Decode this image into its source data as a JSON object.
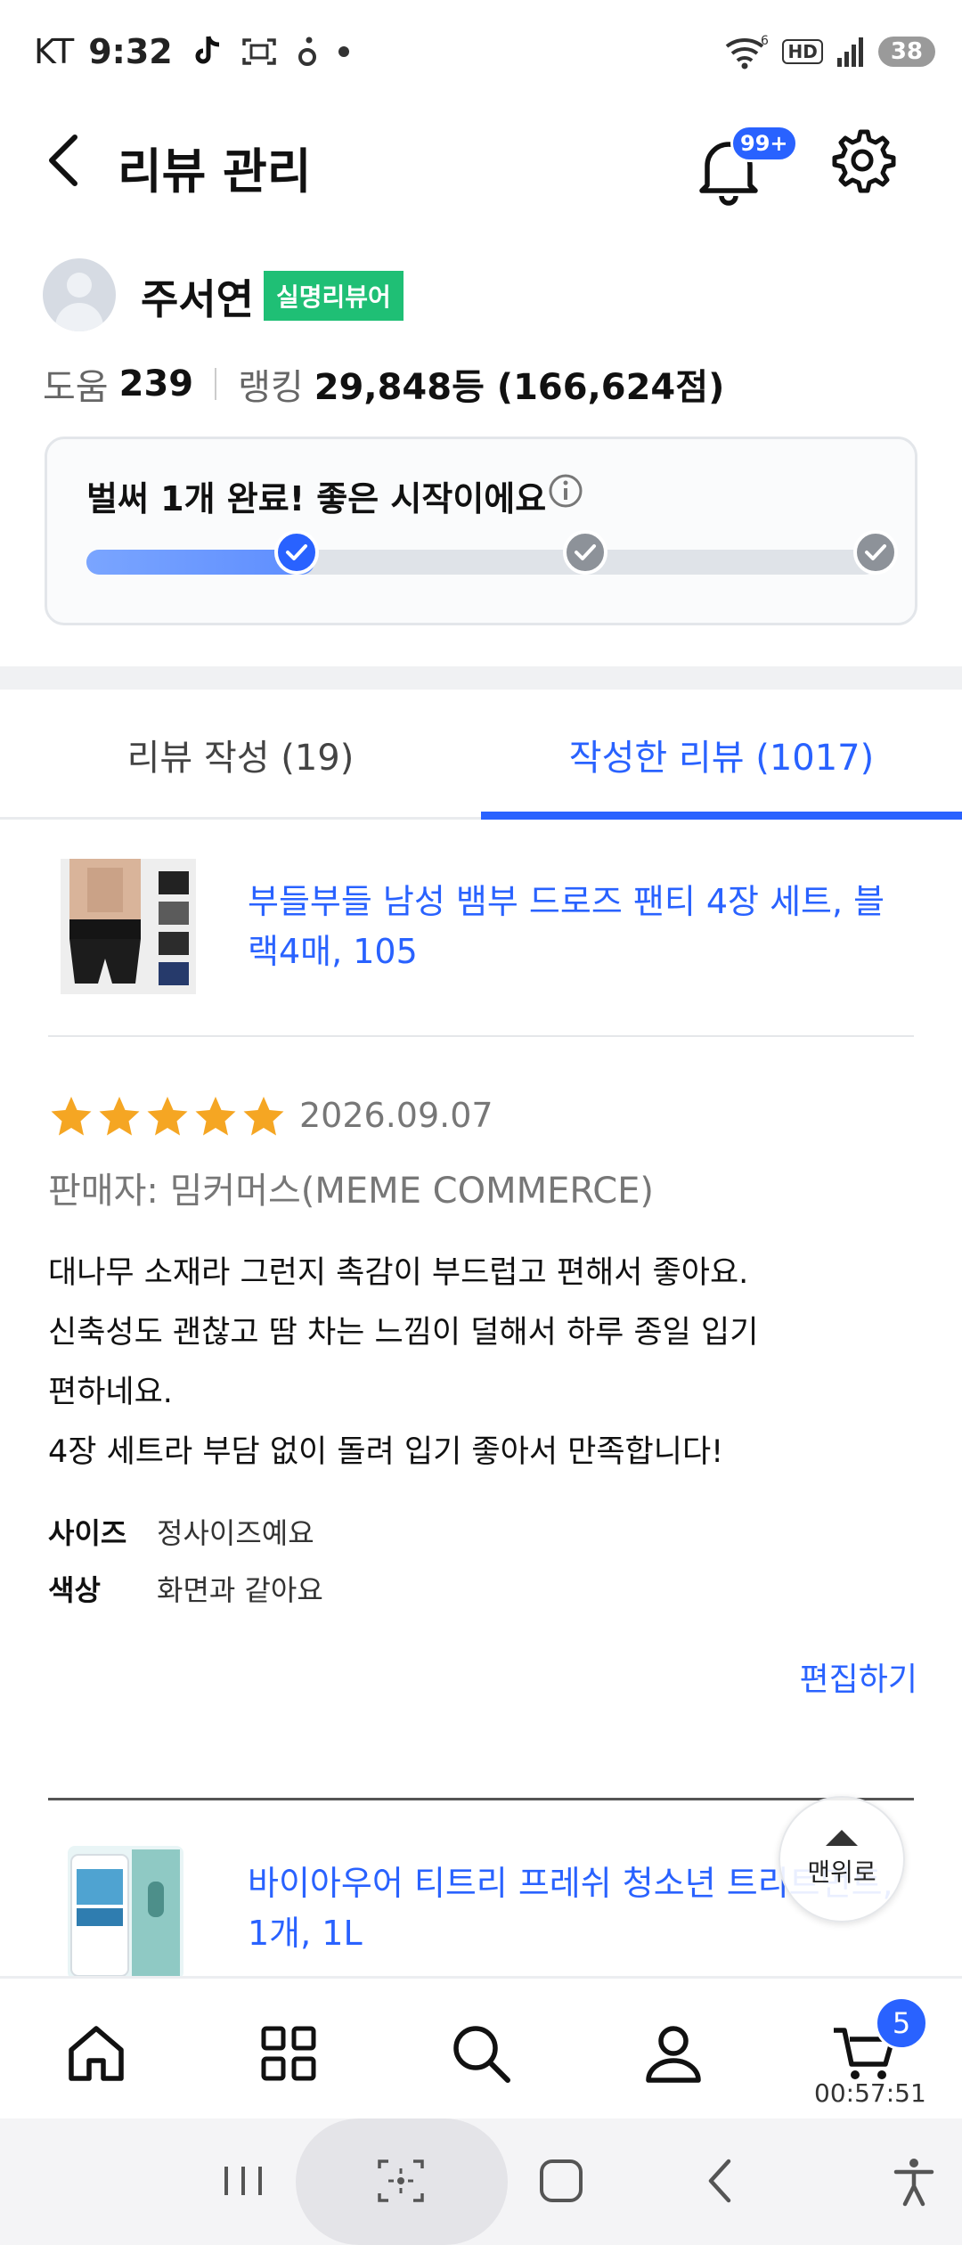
{
  "status_bar": {
    "carrier": "KT",
    "time": "9:32",
    "battery": "38",
    "hd_label": "HD",
    "wifi_superscript": "6"
  },
  "header": {
    "title": "리뷰 관리",
    "notification_badge": "99+"
  },
  "profile": {
    "name": "주서연",
    "badge": "실명리뷰어",
    "help_label": "도움",
    "help_count": "239",
    "ranking_label": "랭킹",
    "ranking_value": "29,848등 (166,624점)"
  },
  "progress": {
    "title": "벌써 1개 완료! 좋은 시작이에요",
    "completed_steps": 1,
    "total_steps": 3
  },
  "tabs": {
    "write": "리뷰 작성 (19)",
    "written": "작성한 리뷰 (1017)",
    "active": "written"
  },
  "review": {
    "product_name": "부들부들 남성 뱀부 드로즈 팬티 4장 세트, 블랙4매, 105",
    "rating": 5,
    "date": "2026.09.07",
    "seller": "판매자: 밈커머스(MEME COMMERCE)",
    "body_lines": [
      "대나무 소재라 그런지 촉감이 부드럽고 편해서 좋아요.",
      "신축성도 괜찮고 땀 차는 느낌이 덜해서 하루 종일 입기",
      "편하네요.",
      "4장 세트라 부담 없이 돌려 입기 좋아서 만족합니다!"
    ],
    "attributes": [
      {
        "key": "사이즈",
        "value": "정사이즈예요"
      },
      {
        "key": "색상",
        "value": "화면과 같아요"
      }
    ],
    "edit_label": "편집하기"
  },
  "next_review": {
    "product_name": "바이아우어 티트리 프레쉬 청소년 트리트먼트, 1개, 1L"
  },
  "scroll_top": {
    "label": "맨위로"
  },
  "bottom_nav": {
    "cart_count": "5",
    "cart_timer": "00:57:51"
  },
  "colors": {
    "accent": "#2962ff",
    "badge_green": "#1fbf75",
    "star": "#f5a623"
  }
}
